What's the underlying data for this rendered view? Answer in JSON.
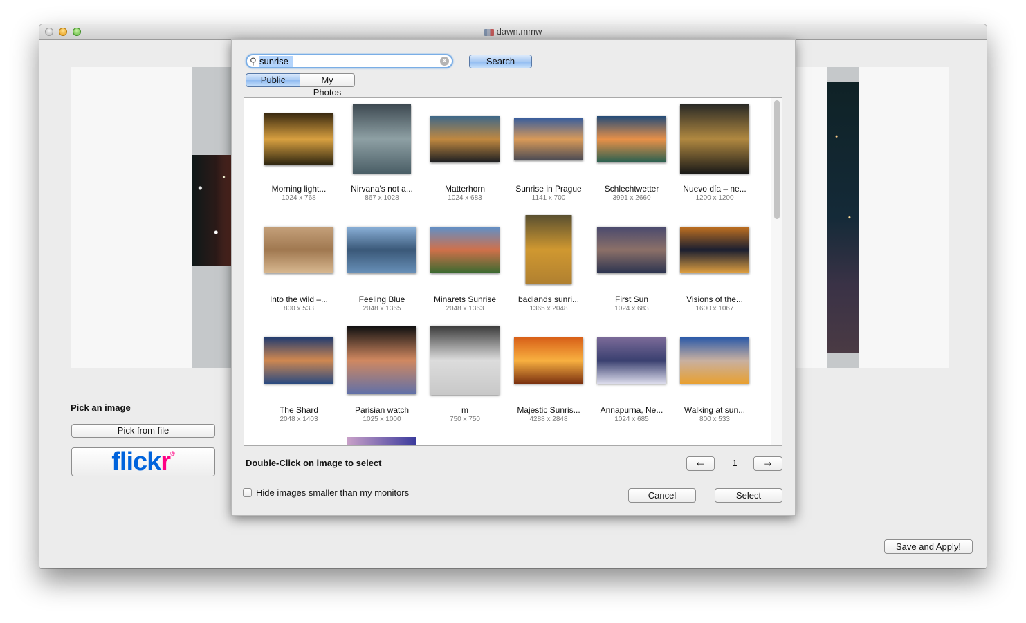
{
  "window": {
    "title": "dawn.mmw",
    "title_icon": "document-icon"
  },
  "main": {
    "pick_label": "Pick an image",
    "pick_file_label": "Pick from file",
    "flickr_button": {
      "part1": "flick",
      "part2": "r",
      "reg": "®"
    },
    "save_apply_label": "Save and Apply!"
  },
  "dialog": {
    "search": {
      "value": "sunrise",
      "placeholder": "",
      "button_label": "Search"
    },
    "segments": [
      {
        "label": "Public",
        "selected": true
      },
      {
        "label": "My Photos",
        "selected": false
      }
    ],
    "photos": [
      {
        "name": "Morning light...",
        "dims": "1024 x 768",
        "colors": [
          "#3a2a10",
          "#d8a040",
          "#2c2410"
        ],
        "w": 100,
        "h": 75
      },
      {
        "name": "Nirvana's not a...",
        "dims": "867 x 1028",
        "colors": [
          "#3e4a52",
          "#8ea0a4",
          "#4a5e66"
        ],
        "w": 84,
        "h": 100
      },
      {
        "name": "Matterhorn",
        "dims": "1024 x 683",
        "colors": [
          "#3f6888",
          "#c08840",
          "#1c1e22"
        ],
        "w": 100,
        "h": 67
      },
      {
        "name": "Sunrise in Prague",
        "dims": "1141 x 700",
        "colors": [
          "#3a5e9c",
          "#d99a58",
          "#4a4a54"
        ],
        "w": 100,
        "h": 61
      },
      {
        "name": "Schlechtwetter",
        "dims": "3991 x 2660",
        "colors": [
          "#244c78",
          "#e89048",
          "#286050"
        ],
        "w": 100,
        "h": 67
      },
      {
        "name": "Nuevo día – ne...",
        "dims": "1200 x 1200",
        "colors": [
          "#2a2a26",
          "#b08840",
          "#1a1a18"
        ],
        "w": 100,
        "h": 100
      },
      {
        "name": "Into the wild –...",
        "dims": "800 x 533",
        "colors": [
          "#c4a07a",
          "#a07850",
          "#d8b890"
        ],
        "w": 100,
        "h": 67
      },
      {
        "name": "Feeling Blue",
        "dims": "2048 x 1365",
        "colors": [
          "#8ab0d8",
          "#3a5878",
          "#6890b8"
        ],
        "w": 100,
        "h": 67
      },
      {
        "name": "Minarets Sunrise",
        "dims": "2048 x 1363",
        "colors": [
          "#6090c8",
          "#d0704a",
          "#3a6a30"
        ],
        "w": 100,
        "h": 67
      },
      {
        "name": "badlands sunri...",
        "dims": "1365 x 2048",
        "colors": [
          "#5a5030",
          "#d09830",
          "#b08030"
        ],
        "w": 67,
        "h": 100
      },
      {
        "name": "First Sun",
        "dims": "1024 x 683",
        "colors": [
          "#4a4a6e",
          "#8c7068",
          "#2c3450"
        ],
        "w": 100,
        "h": 67
      },
      {
        "name": "Visions of the...",
        "dims": "1600 x 1067",
        "colors": [
          "#c07020",
          "#1a1e30",
          "#e0a040"
        ],
        "w": 100,
        "h": 67
      },
      {
        "name": "The Shard",
        "dims": "2048 x 1403",
        "colors": [
          "#1e3a70",
          "#d08850",
          "#2a4a80"
        ],
        "w": 100,
        "h": 68
      },
      {
        "name": "Parisian watch",
        "dims": "1025 x 1000",
        "colors": [
          "#111111",
          "#d08860",
          "#6070a8"
        ],
        "w": 100,
        "h": 98
      },
      {
        "name": "m",
        "dims": "750 x 750",
        "colors": [
          "#3a3a3a",
          "#dcdcdc",
          "#c8c8c8"
        ],
        "w": 100,
        "h": 100
      },
      {
        "name": "Majestic Sunris...",
        "dims": "4288 x 2848",
        "colors": [
          "#d86018",
          "#f8b040",
          "#7a3010"
        ],
        "w": 100,
        "h": 67
      },
      {
        "name": "Annapurna, Ne...",
        "dims": "1024 x 685",
        "colors": [
          "#7a6a98",
          "#3a4070",
          "#dcdcec"
        ],
        "w": 100,
        "h": 67
      },
      {
        "name": "Walking at sun...",
        "dims": "800 x 533",
        "colors": [
          "#2c5aa8",
          "#c8b0a0",
          "#e8a030"
        ],
        "w": 100,
        "h": 67
      }
    ],
    "partial_row_thumb_colors": [
      "#c8a0c8",
      "#3a3a9c"
    ],
    "hint": "Double-Click on image to select",
    "pagination": {
      "prev_label": "⇐",
      "page": "1",
      "next_label": "⇒"
    },
    "hide_small": {
      "label": "Hide images smaller than my monitors",
      "checked": false
    },
    "cancel_label": "Cancel",
    "select_label": "Select"
  }
}
